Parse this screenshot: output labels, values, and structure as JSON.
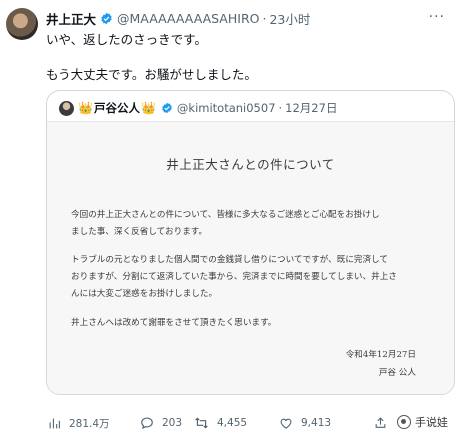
{
  "tweet": {
    "name": "井上正大",
    "handle": "@MAAAAAAAASAHIRO",
    "separator": "·",
    "time": "23小时",
    "more": "···",
    "text_line1": "いや、返したのさっきです。",
    "text_line2": "もう大丈夫です。お騒がせしました。"
  },
  "quote": {
    "crown_left": "👑",
    "name": "戸谷公人",
    "crown_right": "👑",
    "handle": "@kimitotani0507",
    "separator": "·",
    "date": "12月27日",
    "document": {
      "title": "井上正大さんとの件について",
      "paragraph1": "今回の井上正大さんとの件について、皆様に多大なるご迷惑とご心配をお掛けし\nました事、深く反省しております。",
      "paragraph2": "トラブルの元となりました個人間での金銭貸し借りについてですが、既に完済して\nおりますが、分割にて返済していた事から、完済までに時間を要してしまい、井上さ\nんには大変ご迷惑をお掛けしました。",
      "paragraph3": "井上さんへは改めて謝罪をさせて頂きたく思います。",
      "sign_date": "令和4年12月27日",
      "sign_name": "戸谷 公人"
    }
  },
  "actions": {
    "views": "281.4万",
    "replies": "203",
    "retweets": "4,455",
    "likes": "9,413"
  },
  "watermark": {
    "text": "手说娃"
  },
  "colors": {
    "verified": "#1d9bf0",
    "muted": "#536471",
    "border": "#cfd9de"
  }
}
